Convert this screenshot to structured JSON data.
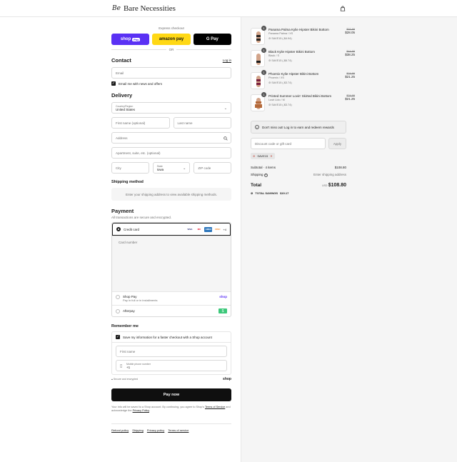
{
  "header": {
    "logo_mark": "Be",
    "brand": "Bare Necessities"
  },
  "express": {
    "title": "Express checkout",
    "shop_label": "shop",
    "shop_pay": "Pay",
    "amazon_label": "amazon pay",
    "gpay_label": "G Pay",
    "or": "OR"
  },
  "contact": {
    "title": "Contact",
    "login": "Log in",
    "email_placeholder": "Email",
    "news_label": "Email me with news and offers"
  },
  "delivery": {
    "title": "Delivery",
    "country_label": "Country/Region",
    "country_value": "United States",
    "first_name": "First name (optional)",
    "last_name": "Last name",
    "address": "Address",
    "apartment": "Apartment, suite, etc. (optional)",
    "city": "City",
    "state_label": "State",
    "state_value": "Iowa",
    "zip": "ZIP code"
  },
  "shipping": {
    "title": "Shipping method",
    "message": "Enter your shipping address to view available shipping methods."
  },
  "payment": {
    "title": "Payment",
    "subtitle": "All transactions are secure and encrypted.",
    "credit_card": "Credit card",
    "cards": [
      "VISA",
      "MC",
      "AMEX",
      "DISC"
    ],
    "more_cards": "+4",
    "card_number": "Card number",
    "shop_pay": "Shop Pay",
    "shop_pay_sub": "Pay in full or in installments",
    "shop_logo": "shop",
    "afterpay": "Afterpay"
  },
  "remember": {
    "title": "Remember me",
    "save_label": "Save my information for a faster checkout with a Shop account",
    "first_name": "First name",
    "phone_label": "Mobile phone number",
    "phone_value": "+1",
    "secure": "Secure and encrypted",
    "shop_logo": "shop"
  },
  "pay_now": "Pay now",
  "legal": {
    "prefix": "Your info will be saved to a Shop account. By continuing, you agree to Shop's ",
    "terms": "Terms of Service",
    "middle": " and acknowledge the ",
    "privacy": "Privacy Policy",
    "suffix": "."
  },
  "footer": [
    "Refund policy",
    "Shipping",
    "Privacy policy",
    "Terms of service"
  ],
  "cart": {
    "items": [
      {
        "qty": "1",
        "name": "Panama Palma Kylie Hipster Bikini Bottom",
        "variant": "Panama Palma / XS",
        "discount": "SAVE15 (-$4.94)",
        "old": "$32.99",
        "price": "$28.05",
        "color": "#2a2522"
      },
      {
        "qty": "1",
        "name": "Black Kylie Hipster Bikini Bottom",
        "variant": "Black / S",
        "discount": "SAVE15 (-$6.74)",
        "old": "$44.99",
        "price": "$38.25",
        "color": "#1c1c1c"
      },
      {
        "qty": "1",
        "name": "Phoenix Kylie Hipster Bikini Bottom",
        "variant": "Phoenix / XS",
        "discount": "SAVE15 (-$3.74)",
        "old": "$24.99",
        "price": "$21.25",
        "color": "#7a1f3d"
      },
      {
        "qty": "1",
        "name": "Printed Summer Lovin' Skirted Bikini Bottom",
        "variant": "Lush Lido / M",
        "discount": "SAVE15 (-$3.74)",
        "old": "$24.99",
        "price": "$21.25",
        "color": "#b56a3a"
      }
    ],
    "notice": "Don't miss out! Log in to earn and redeem rewards",
    "discount_placeholder": "Discount code or gift card",
    "apply": "Apply",
    "code": "SAVE15",
    "subtotal_label": "Subtotal · 4 items",
    "subtotal": "$108.80",
    "shipping_label": "Shipping",
    "shipping_value": "Enter shipping address",
    "total_label": "Total",
    "currency": "USD",
    "total": "$108.80",
    "savings_label": "TOTAL SAVINGS",
    "savings": "$19.17"
  }
}
